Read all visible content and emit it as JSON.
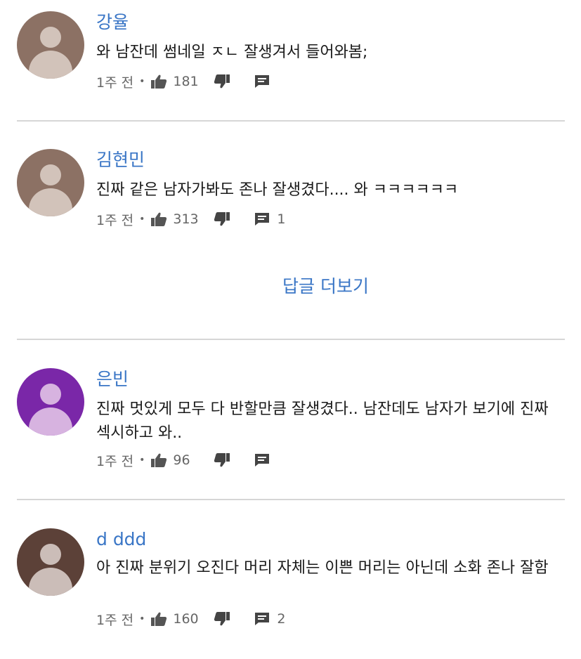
{
  "comments": [
    {
      "author": "강율",
      "text": "와 남잔데 썸네일 ㅈㄴ 잘생겨서 들어와봄;",
      "time": "1주 전",
      "likes": "181",
      "replies": "",
      "avatar_head_color": "#d2c3ba",
      "avatar_bg_color": "#8c7164"
    },
    {
      "author": "김현민",
      "text": "진짜 같은 남자가봐도 존나 잘생겼다.... 와 ㅋㅋㅋㅋㅋㅋ",
      "time": "1주 전",
      "likes": "313",
      "replies": "1",
      "avatar_head_color": "#d2c3ba",
      "avatar_bg_color": "#8c7164"
    },
    {
      "author": "은빈",
      "text": "진짜 멋있게 모두 다 반할만큼 잘생겼다.. 남잔데도 남자가 보기에 진짜 섹시하고 와..",
      "time": "1주 전",
      "likes": "96",
      "replies": "",
      "avatar_head_color": "#d7b3e0",
      "avatar_bg_color": "#7a27a8"
    },
    {
      "author": "d ddd",
      "text": "아 진짜 분위기 오진다 머리 자체는 이쁜 머리는 아닌데 소화 존나 잘함",
      "time": "1주 전",
      "likes": "160",
      "replies": "2",
      "avatar_head_color": "#cbbdb8",
      "avatar_bg_color": "#5c4138"
    }
  ],
  "more_replies_label": "답글 더보기",
  "separator": "•",
  "icons": {
    "like": "thumbs-up-icon",
    "dislike": "thumbs-down-icon",
    "reply": "comment-icon"
  },
  "colors": {
    "author": "#3a76c6",
    "meta": "#666666",
    "divider": "#d6d6d6"
  }
}
